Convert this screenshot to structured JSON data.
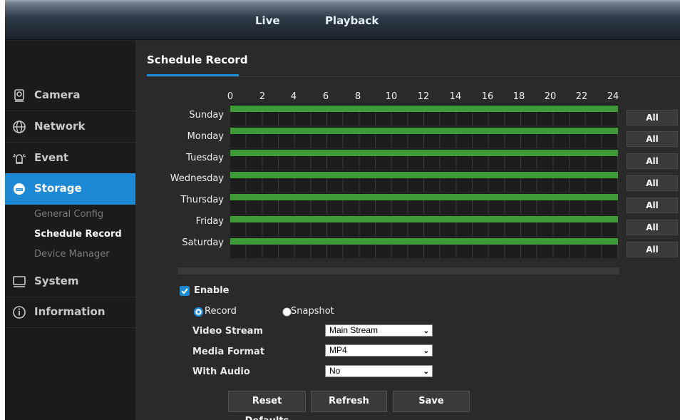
{
  "topnav": {
    "live": "Live",
    "playback": "Playback"
  },
  "sidebar": {
    "items": [
      {
        "label": "Camera",
        "icon": "camera-icon"
      },
      {
        "label": "Network",
        "icon": "globe-icon"
      },
      {
        "label": "Event",
        "icon": "alarm-icon"
      },
      {
        "label": "Storage",
        "icon": "storage-icon"
      },
      {
        "label": "System",
        "icon": "monitor-icon"
      },
      {
        "label": "Information",
        "icon": "info-icon"
      }
    ],
    "storage_sub": [
      "General Config",
      "Schedule Record",
      "Device Manager"
    ],
    "active": "Storage",
    "current_sub": "Schedule Record"
  },
  "main": {
    "title": "Schedule Record",
    "hours": [
      "0",
      "2",
      "4",
      "6",
      "8",
      "10",
      "12",
      "14",
      "16",
      "18",
      "20",
      "22",
      "24"
    ],
    "days": [
      "Sunday",
      "Monday",
      "Tuesday",
      "Wednesday",
      "Thursday",
      "Friday",
      "Saturday"
    ],
    "day_record_coverage": [
      1,
      1,
      1,
      1,
      1,
      1,
      1
    ],
    "all_label": "All",
    "enable": {
      "label": "Enable",
      "checked": true
    },
    "mode": {
      "record_label": "Record",
      "snapshot_label": "Snapshot",
      "selected": "Record"
    },
    "video_stream": {
      "label": "Video Stream",
      "value": "Main Stream"
    },
    "media_format": {
      "label": "Media Format",
      "value": "MP4"
    },
    "with_audio": {
      "label": "With Audio",
      "value": "No"
    },
    "buttons": {
      "reset": "Reset Defaults",
      "refresh": "Refresh",
      "save": "Save"
    }
  },
  "colors": {
    "accent": "#1e8ad6",
    "record_bar": "#3e9a36",
    "background": "#2a2a2a",
    "sidebar": "#1b1b1b"
  }
}
